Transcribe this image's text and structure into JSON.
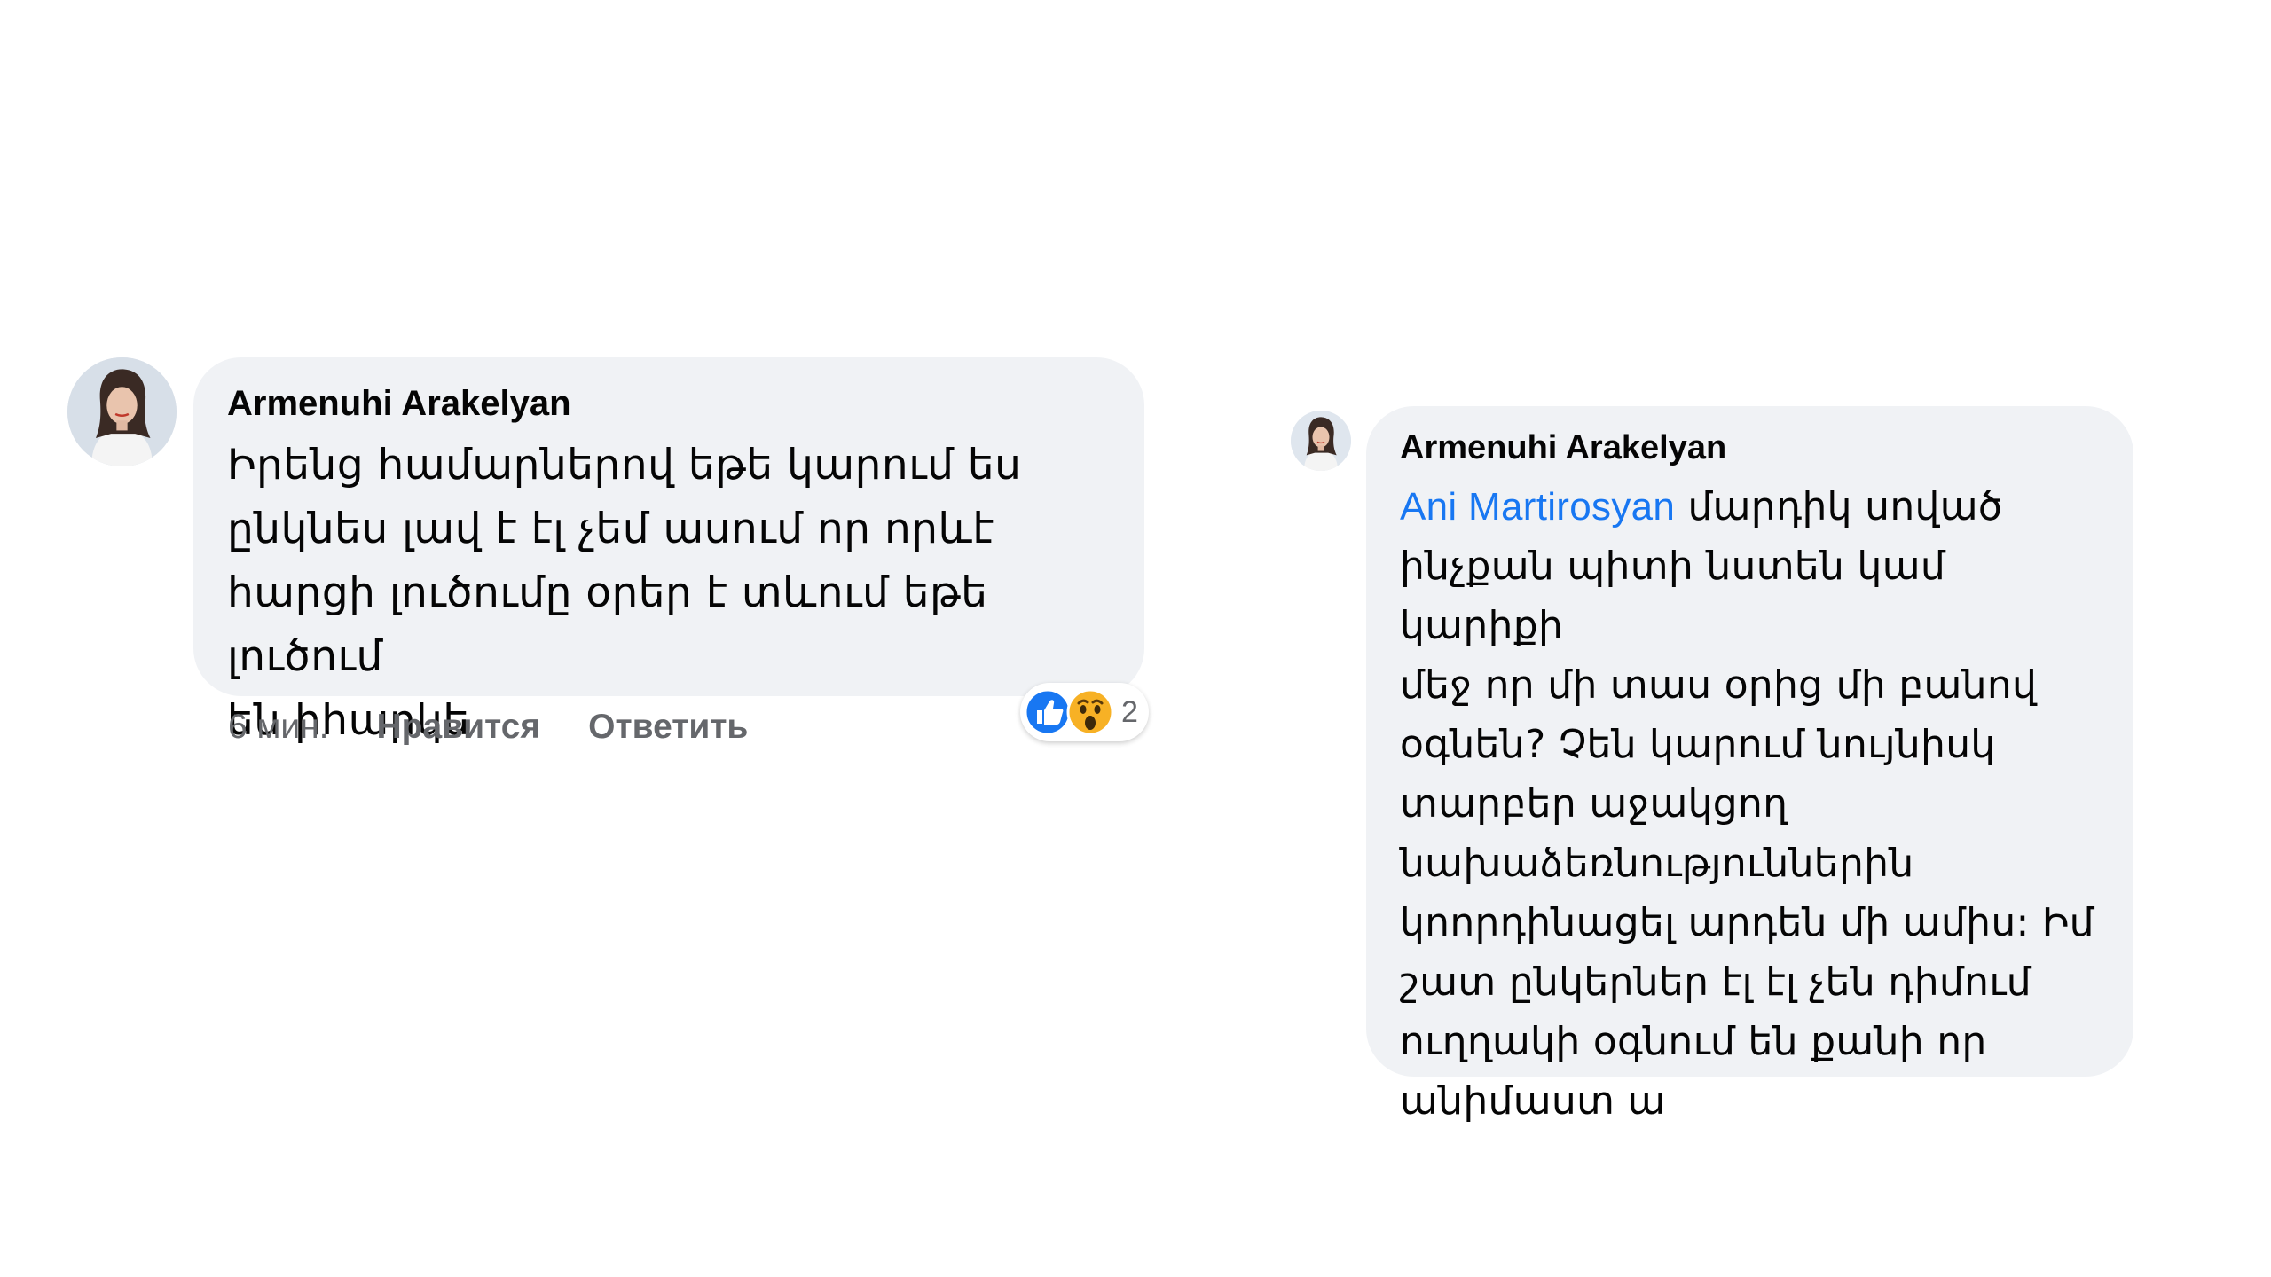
{
  "comments": [
    {
      "author": "Armenuhi Arakelyan",
      "text_lines": [
        "Իրենց համարներով եթե կարում  ես",
        "ընկնես լավ է էլ չեմ ասում որ որևէ",
        "հարցի լուծումը օրեր է տևում եթե լուծում",
        "են իհարկե"
      ],
      "time": "6 мин.",
      "like_label": "Нравится",
      "reply_label": "Ответить",
      "reactions": {
        "icons": [
          "like-icon",
          "wow-icon"
        ],
        "count": "2"
      }
    },
    {
      "author": "Armenuhi Arakelyan",
      "mention": "Ani Martirosyan",
      "text_lines": [
        " մարդիկ սոված",
        "ինչքան պիտի նստեն կամ կարիքի",
        "մեջ որ մի տաս օրից մի բանով",
        "օգնեն? Չեն կարում նույնիսկ",
        "տարբեր աջակցող",
        "նախաձեռնություններին",
        "կոորդինացել արդեն մի ամիս: Իմ",
        "շատ ընկերներ էլ էլ չեն դիմում",
        "ուղղակի օգնում են քանի որ",
        "անիմաստ ա"
      ]
    }
  ],
  "colors": {
    "bubble": "#f0f2f5",
    "mention": "#1877f2",
    "meta": "#65676b",
    "like_blue": "#1877f2",
    "wow_yellow": "#f7b125"
  }
}
